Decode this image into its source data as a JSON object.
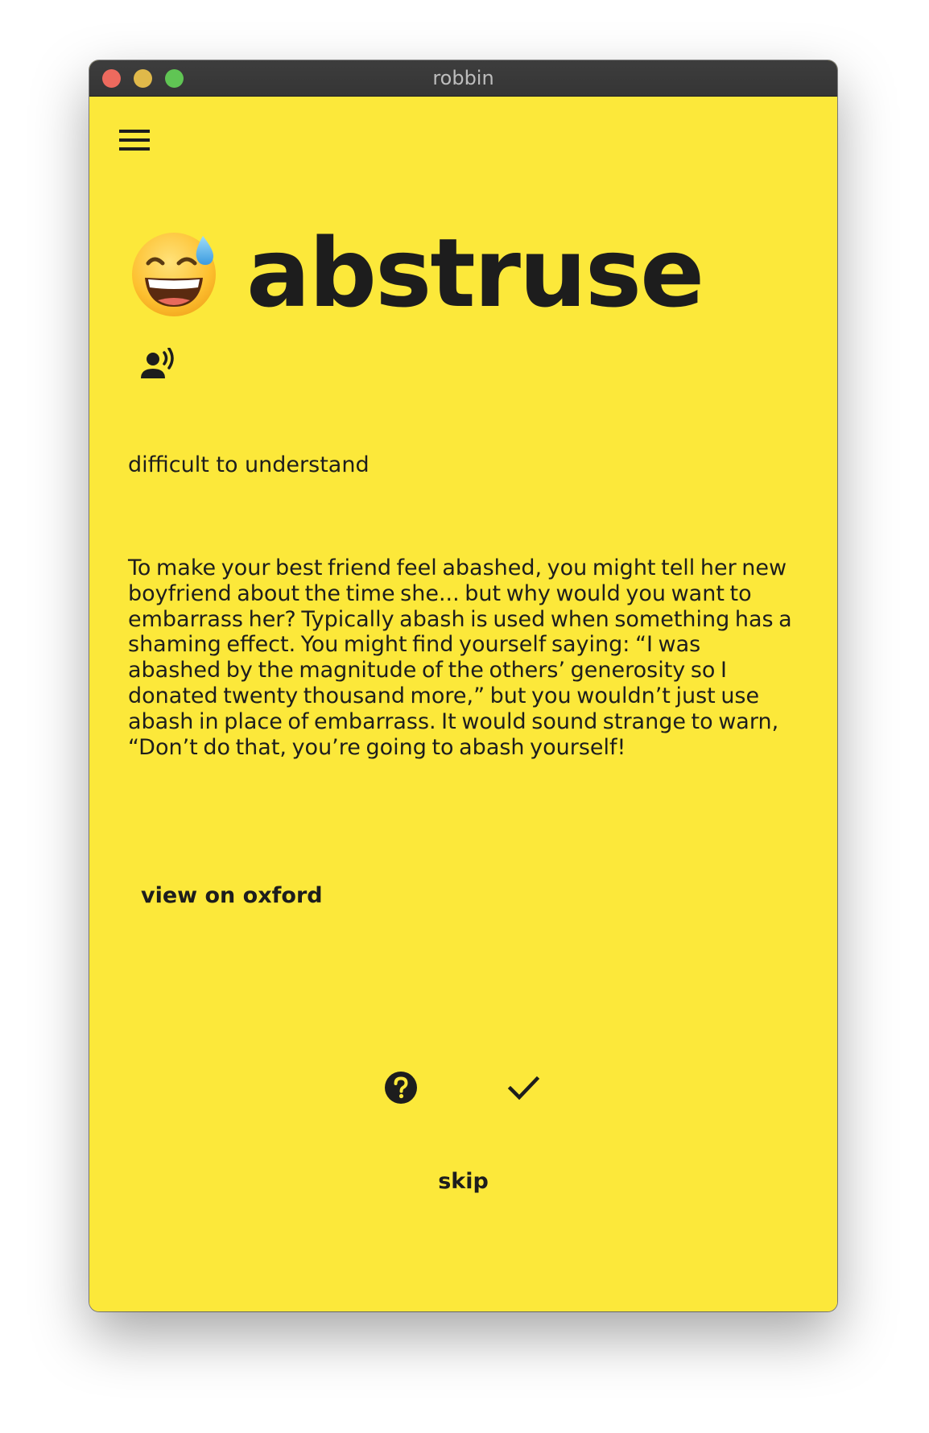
{
  "window": {
    "title": "robbin"
  },
  "header": {
    "menu_icon": "hamburger-menu-icon"
  },
  "word": {
    "emoji": "grinning-face-with-sweat-emoji",
    "text": "abstruse",
    "pronounce_icon": "record-voice-over-icon"
  },
  "definition": "difficult to understand",
  "description": "To make your best friend feel abashed, you might tell her new boyfriend about the time she... but why would you want to embarrass her? Typically abash is used when something has a shaming effect. You might find yourself saying: “I was abashed by the magnitude of the others’ generosity so I donated twenty thousand more,” but you wouldn’t just use abash in place of embarrass. It would sound strange to warn, “Don’t do that, you’re going to abash yourself!",
  "links": {
    "oxford_label": "view on oxford"
  },
  "actions": {
    "help_icon": "help-circle-icon",
    "check_icon": "check-icon",
    "skip_label": "skip"
  },
  "colors": {
    "background": "#FCE83A",
    "text": "#1d1d1d",
    "titlebar": "#3a3a3a"
  }
}
